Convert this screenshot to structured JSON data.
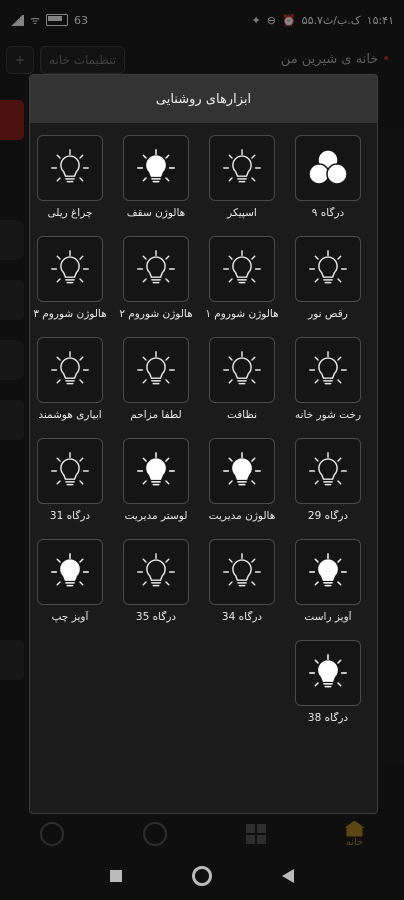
{
  "status": {
    "time": "۱۵:۴۱",
    "data_rate": "۵۵.۷ک.ب/ث",
    "battery": "63"
  },
  "background": {
    "add_button": "+",
    "settings_button": "تنظیمات خانه",
    "home_title": "خانه ی شیرین من",
    "home_tab": "خانه"
  },
  "dialog": {
    "title": "ابزارهای روشنایی",
    "tiles": [
      {
        "label": "درگاه ۹",
        "icon": "scene-circles-icon",
        "state": "on"
      },
      {
        "label": "اسپیکر",
        "icon": "bulb-icon",
        "state": "off"
      },
      {
        "label": "هالوژن سقف",
        "icon": "bulb-icon",
        "state": "on"
      },
      {
        "label": "چراغ ریلی",
        "icon": "bulb-icon",
        "state": "off"
      },
      {
        "label": "رقص نور",
        "icon": "bulb-icon",
        "state": "off"
      },
      {
        "label": "هالوژن شوروم ۱",
        "icon": "bulb-icon",
        "state": "off"
      },
      {
        "label": "هالوژن شوروم ۲",
        "icon": "bulb-icon",
        "state": "off"
      },
      {
        "label": "هالوژن شوروم ۳",
        "icon": "bulb-icon",
        "state": "off"
      },
      {
        "label": "رخت شور خانه",
        "icon": "bulb-icon",
        "state": "off"
      },
      {
        "label": "نظافت",
        "icon": "bulb-icon",
        "state": "off"
      },
      {
        "label": "لطفا مزاحم",
        "icon": "bulb-icon",
        "state": "off"
      },
      {
        "label": "ابیاری هوشمند",
        "icon": "bulb-icon",
        "state": "off"
      },
      {
        "label": "درگاه 29",
        "icon": "bulb-icon",
        "state": "off"
      },
      {
        "label": "هالوژن مدیریت",
        "icon": "bulb-icon",
        "state": "on"
      },
      {
        "label": "لوستر مدیریت",
        "icon": "bulb-icon",
        "state": "on"
      },
      {
        "label": "درگاه 31",
        "icon": "bulb-icon",
        "state": "off"
      },
      {
        "label": "آویز راست",
        "icon": "bulb-icon",
        "state": "on"
      },
      {
        "label": "درگاه 34",
        "icon": "bulb-icon",
        "state": "off"
      },
      {
        "label": "درگاه 35",
        "icon": "bulb-icon",
        "state": "off"
      },
      {
        "label": "آویز چپ",
        "icon": "bulb-icon",
        "state": "on"
      },
      {
        "label": "درگاه 38",
        "icon": "bulb-icon",
        "state": "on"
      }
    ]
  }
}
